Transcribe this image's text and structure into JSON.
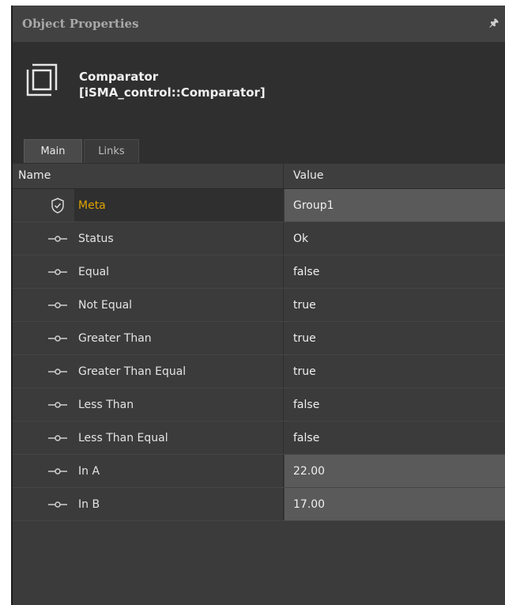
{
  "panel": {
    "title": "Object Properties",
    "pin_icon": "pin-icon"
  },
  "object": {
    "name": "Comparator",
    "type": "[iSMA_control::Comparator]",
    "icon": "component-icon"
  },
  "tabs": [
    {
      "label": "Main",
      "active": true
    },
    {
      "label": "Links",
      "active": false
    }
  ],
  "table": {
    "columns": [
      "Name",
      "Value"
    ],
    "rows": [
      {
        "name": "Meta",
        "value": "Group1",
        "icon": "shield-check-icon",
        "editable": true
      },
      {
        "name": "Status",
        "value": "Ok",
        "icon": "slot-icon",
        "editable": false
      },
      {
        "name": "Equal",
        "value": "false",
        "icon": "slot-icon",
        "editable": false
      },
      {
        "name": "Not Equal",
        "value": "true",
        "icon": "slot-icon",
        "editable": false
      },
      {
        "name": "Greater Than",
        "value": "true",
        "icon": "slot-icon",
        "editable": false
      },
      {
        "name": "Greater Than Equal",
        "value": "true",
        "icon": "slot-icon",
        "editable": false
      },
      {
        "name": "Less Than",
        "value": "false",
        "icon": "slot-icon",
        "editable": false
      },
      {
        "name": "Less Than Equal",
        "value": "false",
        "icon": "slot-icon",
        "editable": false
      },
      {
        "name": "In A",
        "value": "22.00",
        "icon": "slot-icon",
        "editable": true
      },
      {
        "name": "In B",
        "value": "17.00",
        "icon": "slot-icon",
        "editable": true
      }
    ]
  },
  "colors": {
    "meta_label": "#e0a300",
    "panel_bg": "#3b3b3b",
    "header_bg": "#2f2f2f",
    "editable_value_bg": "#5a5a5a"
  }
}
